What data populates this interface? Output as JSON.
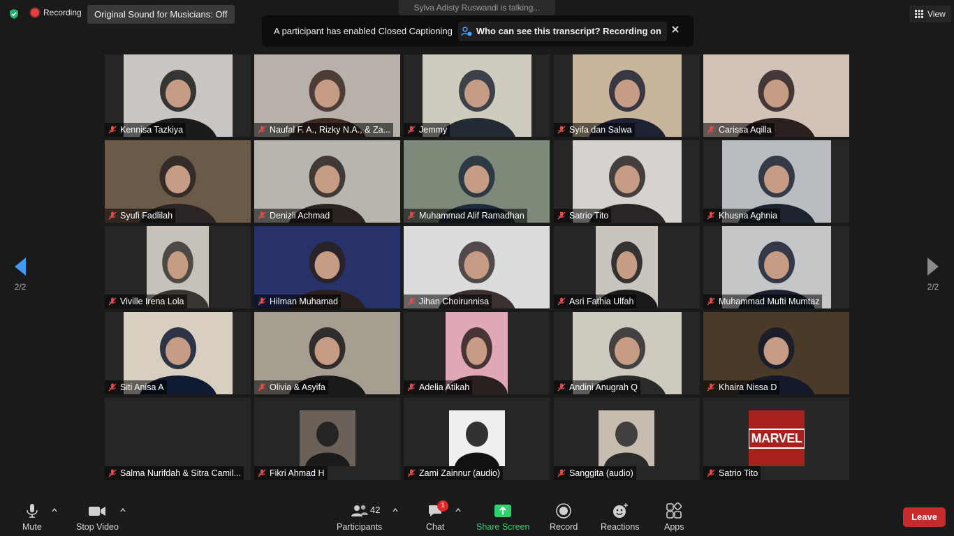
{
  "top": {
    "recording_label": "Recording",
    "original_sound": "Original Sound for Musicians: Off",
    "talking": "Sylva Adisty Ruswandi is talking...",
    "view_label": "View"
  },
  "banner": {
    "message": "A participant has enabled Closed Captioning",
    "transcript_question": "Who can see this transcript? Recording on"
  },
  "page": {
    "left_indicator": "2/2",
    "right_indicator": "2/2"
  },
  "participants": [
    {
      "name": "Kennisa Tazkiya",
      "bg": "#c9c5c2",
      "fg": "#1b1b1b"
    },
    {
      "name": "Naufal F. A., Rizky N.A., & Za...",
      "bg": "#b7b1aa",
      "fg": "#3a2a22"
    },
    {
      "name": "Jemmy",
      "bg": "#cfcbbe",
      "fg": "#222a33"
    },
    {
      "name": "Syifa dan Salwa",
      "bg": "#c9b59c",
      "fg": "#1d2233"
    },
    {
      "name": "Carissa Aqilla",
      "bg": "#d2c2b8",
      "fg": "#2a2020"
    },
    {
      "name": "Syufi Fadlilah",
      "bg": "#6b5a48",
      "fg": "#2a2424"
    },
    {
      "name": "Denizli Achmad",
      "bg": "#b8b4ae",
      "fg": "#2b2320"
    },
    {
      "name": "Muhammad Alif Ramadhan",
      "bg": "#7d8a7a",
      "fg": "#1f2a3a"
    },
    {
      "name": "Satrio Tito",
      "bg": "#d6d3cf",
      "fg": "#2a2424"
    },
    {
      "name": "Khusna Aghnia",
      "bg": "#b9bcc0",
      "fg": "#1c2430"
    },
    {
      "name": "Viville Irena Lola",
      "bg": "#c6c2ba",
      "fg": "#3a3430"
    },
    {
      "name": "Hilman Muhamad",
      "bg": "#27326b",
      "fg": "#2b2020"
    },
    {
      "name": "Jihan Choirunnisa",
      "bg": "#dcdcdc",
      "fg": "#3a3030"
    },
    {
      "name": "Asri Fathia Ulfah",
      "bg": "#c9c4be",
      "fg": "#1a1a1a"
    },
    {
      "name": "Muhammad Mufti Mumtaz",
      "bg": "#c4c6c8",
      "fg": "#1a2030"
    },
    {
      "name": "Siti Anisa A",
      "bg": "#d9cfc0",
      "fg": "#0d1a30"
    },
    {
      "name": "Olivia & Asyifa",
      "bg": "#a79e92",
      "fg": "#1a1a1a"
    },
    {
      "name": "Adelia Atikah",
      "bg": "#e0a7b6",
      "fg": "#2a2020"
    },
    {
      "name": "Andini Anugrah Q",
      "bg": "#cfcac0",
      "fg": "#2a2a2a"
    },
    {
      "name": "Khaira Nissa D",
      "bg": "#4b3a28",
      "fg": "#141a2a"
    },
    {
      "name": "Salma Nurifdah & Sitra Camil...",
      "bg": "",
      "fg": ""
    },
    {
      "name": "Fikri Ahmad H",
      "bg": "#6b6158",
      "fg": "#1a1a1a"
    },
    {
      "name": "Zami Zainnur (audio)",
      "bg": "#efefef",
      "fg": "#111111"
    },
    {
      "name": "Sanggita (audio)",
      "bg": "#c6bcb0",
      "fg": "#2a2a2a"
    },
    {
      "name": "Satrio Tito",
      "bg": "#a8201d",
      "fg": "#ffffff",
      "logo_text": "MARVEL"
    }
  ],
  "toolbar": {
    "mute": "Mute",
    "stop_video": "Stop Video",
    "participants": "Participants",
    "participants_count": "42",
    "chat": "Chat",
    "chat_badge": "1",
    "share_screen": "Share Screen",
    "record": "Record",
    "reactions": "Reactions",
    "apps": "Apps",
    "leave": "Leave"
  },
  "colors": {
    "accent_green": "#2dd36f",
    "leave_red": "#c72a2a",
    "muted_red": "#e04b4b"
  }
}
